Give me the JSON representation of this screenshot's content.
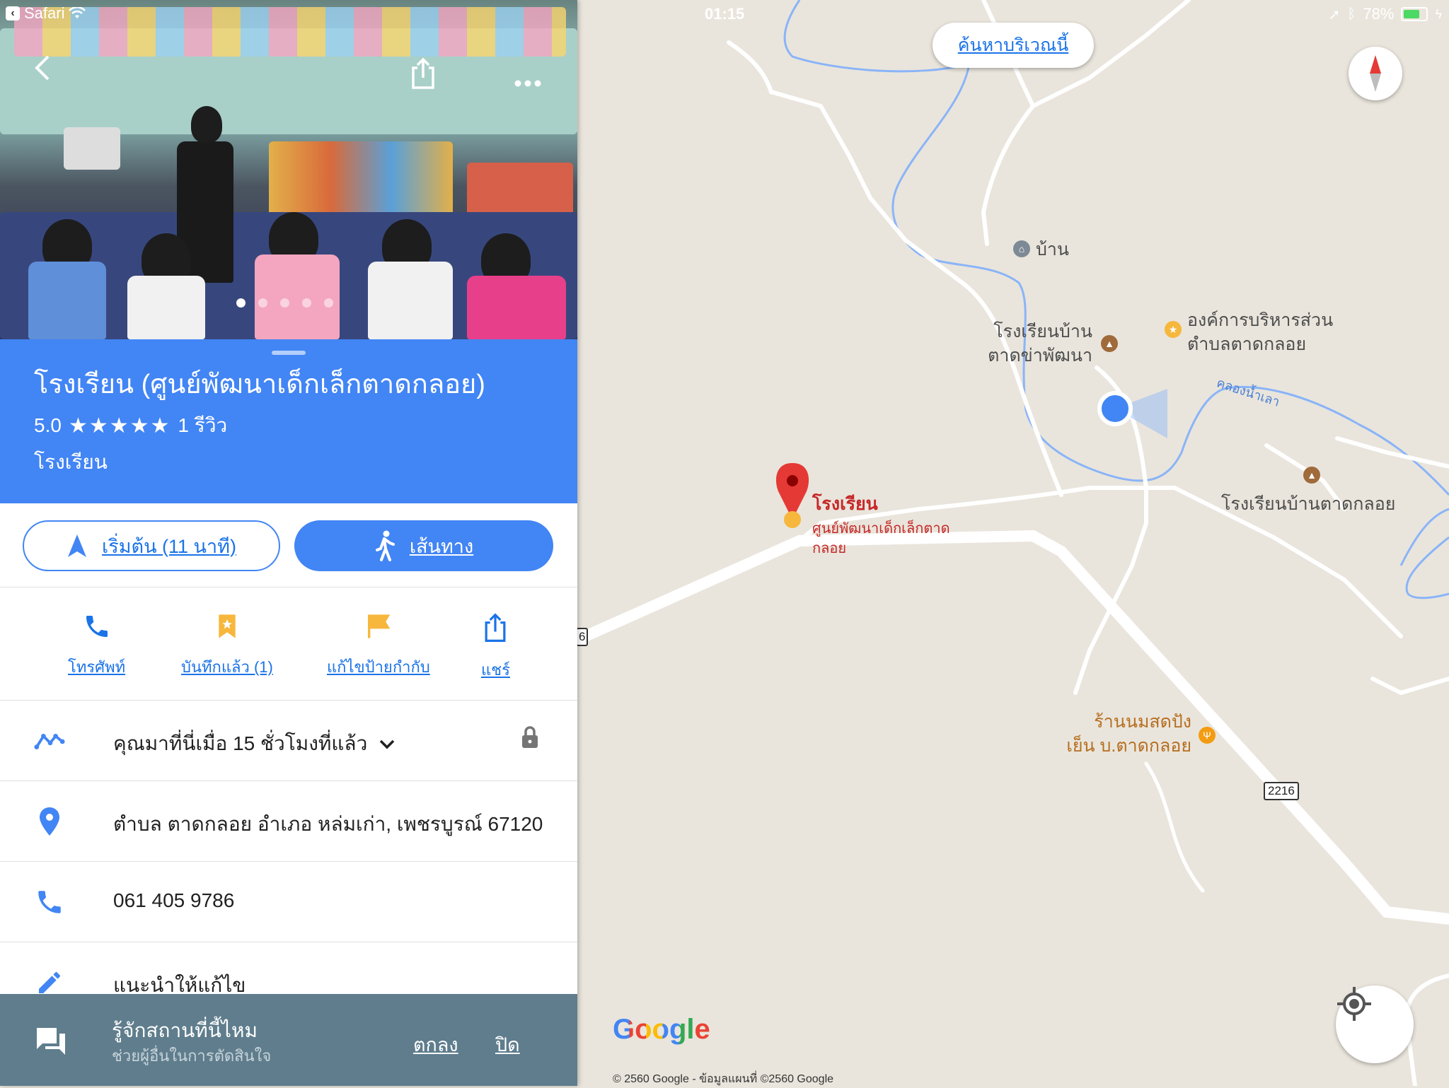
{
  "status_bar": {
    "back_app": "Safari",
    "time": "01:15",
    "battery": "78%",
    "battery_level": 0.78
  },
  "map": {
    "search_area_label": "ค้นหาบริเวณนี้",
    "labels": {
      "home": "บ้าน",
      "school_1_line1": "โรงเรียนบ้าน",
      "school_1_line2": "ตาดข่าพัฒนา",
      "sao_line1": "องค์การบริหารส่วน",
      "sao_line2": "ตำบลตาดกลอย",
      "canal": "คลองน้ำเลา",
      "school_2": "โรงเรียนบ้านตาดกลอย",
      "shop_line1": "ร้านนมสดปัง",
      "shop_line2": "เย็น บ.ตาดกลอย",
      "pin_title": "โรงเรียน",
      "pin_sub_line1": "ศูนย์พัฒนาเด็กเล็กตาด",
      "pin_sub_line2": "กลอย",
      "route_2216": "2216",
      "route_left": "6"
    },
    "google_logo": "Google",
    "copyright": "© 2560 Google - ข้อมูลแผนที่ ©2560 Google"
  },
  "panel": {
    "photo": {
      "dot_count": 5,
      "active_dot": 0
    },
    "title": "โรงเรียน (ศูนย์พัฒนาเด็กเล็กตาดกลอย)",
    "rating": "5.0",
    "stars": "★★★★★",
    "reviews": "1 รีวิว",
    "category": "โรงเรียน",
    "start_label": "เริ่มต้น (11 นาที)",
    "directions_label": "เส้นทาง",
    "quick_actions": {
      "call": "โทรศัพท์",
      "saved": "บันทึกแล้ว (1)",
      "edit_label": "แก้ไขป้ายกำกับ",
      "share": "แชร์"
    },
    "visited": "คุณมาที่นี่เมื่อ 15 ชั่วโมงที่แล้ว",
    "address": "ตำบล ตาดกลอย อำเภอ หล่มเก่า, เพชรบูรณ์ 67120",
    "phone": "061 405 9786",
    "suggest_edit": "แนะนำให้แก้ไข",
    "prompt": {
      "question": "รู้จักสถานที่นี้ไหม",
      "sub": "ช่วยผู้อื่นในการตัดสินใจ",
      "ok": "ตกลง",
      "close": "ปิด"
    }
  },
  "colors": {
    "accent": "#4285f4",
    "link": "#1a73e8",
    "pin_red": "#d32f2f",
    "poi_brown": "#a06a3a",
    "map_bg": "#e9e5dc",
    "prompt_bg": "#5f7d8d"
  }
}
